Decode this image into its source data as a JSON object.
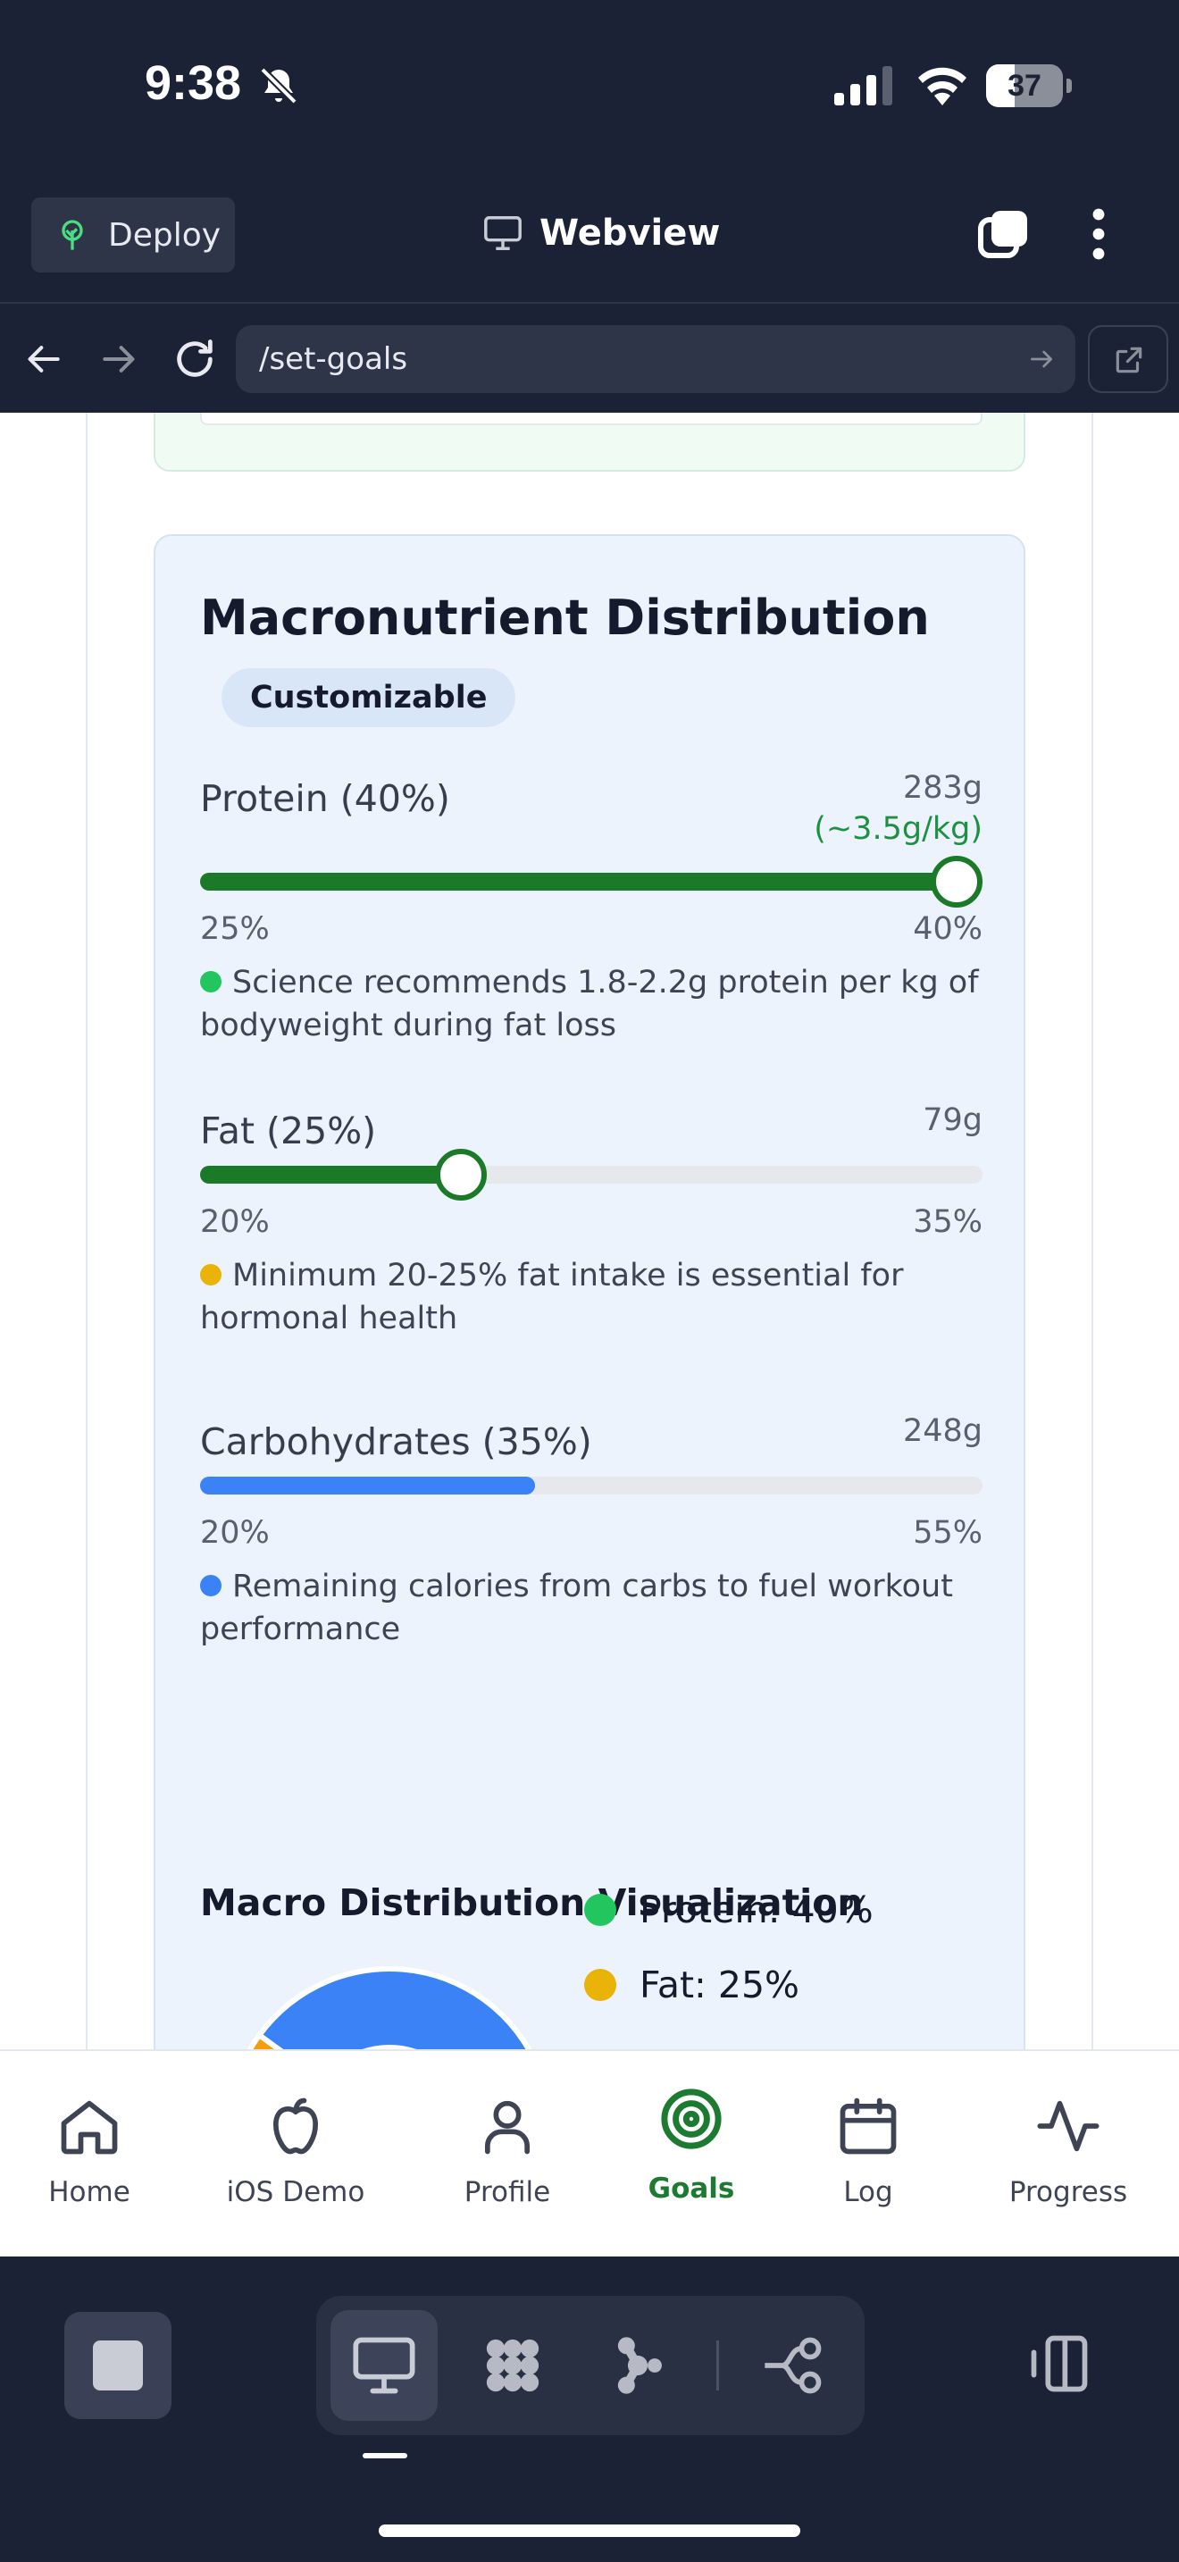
{
  "status_bar": {
    "time": "9:38",
    "battery": "37",
    "battery_level": 0.37
  },
  "header": {
    "deploy_label": "Deploy",
    "title": "Webview"
  },
  "url_bar": {
    "path": "/set-goals"
  },
  "macro_card": {
    "title": "Macronutrient Distribution",
    "badge": "Customizable",
    "macros": [
      {
        "label": "Protein (40%)",
        "grams": "283g",
        "per_kg": "(~3.5g/kg)",
        "min_label": "25%",
        "max_label": "40%",
        "fill_fraction": 1.0,
        "fill_color": "#1a7a28",
        "show_thumb": true,
        "tip": "Science recommends 1.8-2.2g protein per kg of bodyweight during fat loss",
        "tip_color": "#22c55e"
      },
      {
        "label": "Fat (25%)",
        "grams": "79g",
        "min_label": "20%",
        "max_label": "35%",
        "fill_fraction": 0.3333,
        "fill_color": "#1a7a28",
        "show_thumb": true,
        "tip": "Minimum 20-25% fat intake is essential for hormonal health",
        "tip_color": "#eab308"
      },
      {
        "label": "Carbohydrates (35%)",
        "grams": "248g",
        "min_label": "20%",
        "max_label": "55%",
        "fill_fraction": 0.4286,
        "fill_color": "#3b82f6",
        "show_thumb": false,
        "tip": "Remaining calories from carbs to fuel workout performance",
        "tip_color": "#3b82f6"
      }
    ],
    "visualization": {
      "title": "Macro Distribution Visualization",
      "legend": [
        {
          "label": "Protein: 40%",
          "color": "#22c55e"
        },
        {
          "label": "Fat: 25%",
          "color": "#eab308"
        }
      ]
    }
  },
  "chart_data": {
    "type": "pie",
    "categories": [
      "Protein",
      "Fat",
      "Carbohydrates"
    ],
    "values": [
      40,
      25,
      35
    ],
    "colors": [
      "#22c55e",
      "#f59e0b",
      "#3b82f6"
    ],
    "title": "Macro Distribution Visualization"
  },
  "tabbar": {
    "items": [
      {
        "label": "Home",
        "icon": "home-icon",
        "active": false
      },
      {
        "label": "iOS Demo",
        "icon": "apple-icon",
        "active": false
      },
      {
        "label": "Profile",
        "icon": "person-icon",
        "active": false
      },
      {
        "label": "Goals",
        "icon": "target-icon",
        "active": true
      },
      {
        "label": "Log",
        "icon": "calendar-icon",
        "active": false
      },
      {
        "label": "Progress",
        "icon": "activity-icon",
        "active": false
      }
    ],
    "active_color": "#1d7a31"
  }
}
